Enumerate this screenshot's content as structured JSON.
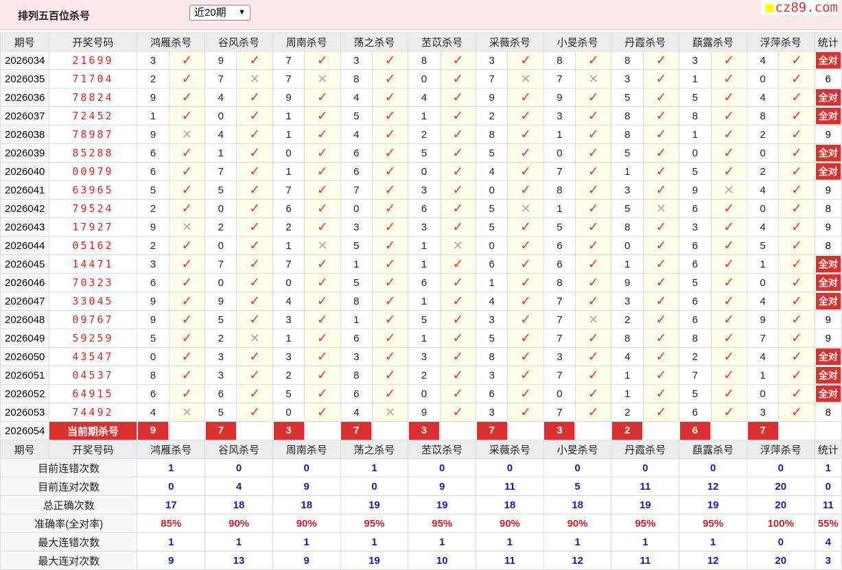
{
  "page": {
    "title": "排列五百位杀号",
    "period_select": "近20期",
    "watermark": "cz89.com"
  },
  "header": {
    "issue": "期号",
    "drawn": "开奖号码",
    "experts": [
      "鸿雁杀号",
      "谷风杀号",
      "周南杀号",
      "荡之杀号",
      "苤苡杀号",
      "采薇杀号",
      "小旻杀号",
      "丹霞杀号",
      "蕻露杀号",
      "浮萍杀号"
    ],
    "total": "统计"
  },
  "rows": [
    {
      "issue": "2026034",
      "drawn": "21699",
      "picks": [
        "3",
        "9",
        "7",
        "3",
        "8",
        "3",
        "8",
        "8",
        "3",
        "4"
      ],
      "ok": [
        1,
        1,
        1,
        1,
        1,
        1,
        1,
        1,
        1,
        1
      ],
      "total": "全对"
    },
    {
      "issue": "2026035",
      "drawn": "71704",
      "picks": [
        "2",
        "7",
        "7",
        "8",
        "0",
        "7",
        "7",
        "3",
        "1",
        "0"
      ],
      "ok": [
        1,
        0,
        0,
        1,
        1,
        0,
        0,
        1,
        1,
        1
      ],
      "total": "6"
    },
    {
      "issue": "2026036",
      "drawn": "78824",
      "picks": [
        "9",
        "4",
        "9",
        "4",
        "4",
        "9",
        "9",
        "5",
        "5",
        "4"
      ],
      "ok": [
        1,
        1,
        1,
        1,
        1,
        1,
        1,
        1,
        1,
        1
      ],
      "total": "全对"
    },
    {
      "issue": "2026037",
      "drawn": "72452",
      "picks": [
        "1",
        "0",
        "1",
        "5",
        "1",
        "2",
        "3",
        "8",
        "8",
        "8"
      ],
      "ok": [
        1,
        1,
        1,
        1,
        1,
        1,
        1,
        1,
        1,
        1
      ],
      "total": "全对"
    },
    {
      "issue": "2026038",
      "drawn": "78987",
      "picks": [
        "9",
        "4",
        "1",
        "4",
        "2",
        "8",
        "1",
        "8",
        "1",
        "2"
      ],
      "ok": [
        0,
        1,
        1,
        1,
        1,
        1,
        1,
        1,
        1,
        1
      ],
      "total": "9"
    },
    {
      "issue": "2026039",
      "drawn": "85288",
      "picks": [
        "6",
        "1",
        "0",
        "6",
        "5",
        "5",
        "0",
        "5",
        "0",
        "0"
      ],
      "ok": [
        1,
        1,
        1,
        1,
        1,
        1,
        1,
        1,
        1,
        1
      ],
      "total": "全对"
    },
    {
      "issue": "2026040",
      "drawn": "00979",
      "picks": [
        "6",
        "7",
        "1",
        "6",
        "0",
        "4",
        "7",
        "1",
        "5",
        "2"
      ],
      "ok": [
        1,
        1,
        1,
        1,
        1,
        1,
        1,
        1,
        1,
        1
      ],
      "total": "全对"
    },
    {
      "issue": "2026041",
      "drawn": "63965",
      "picks": [
        "5",
        "5",
        "7",
        "7",
        "3",
        "0",
        "8",
        "3",
        "9",
        "4"
      ],
      "ok": [
        1,
        1,
        1,
        1,
        1,
        1,
        1,
        1,
        0,
        1
      ],
      "total": "9"
    },
    {
      "issue": "2026042",
      "drawn": "79524",
      "picks": [
        "2",
        "0",
        "6",
        "0",
        "6",
        "5",
        "1",
        "5",
        "6",
        "0"
      ],
      "ok": [
        1,
        1,
        1,
        1,
        1,
        0,
        1,
        0,
        1,
        1
      ],
      "total": "8"
    },
    {
      "issue": "2026043",
      "drawn": "17927",
      "picks": [
        "9",
        "2",
        "2",
        "3",
        "3",
        "5",
        "5",
        "8",
        "3",
        "4"
      ],
      "ok": [
        0,
        1,
        1,
        1,
        1,
        1,
        1,
        1,
        1,
        1
      ],
      "total": "9"
    },
    {
      "issue": "2026044",
      "drawn": "05162",
      "picks": [
        "2",
        "0",
        "1",
        "5",
        "1",
        "0",
        "6",
        "0",
        "6",
        "5"
      ],
      "ok": [
        1,
        1,
        0,
        1,
        0,
        1,
        1,
        1,
        1,
        1
      ],
      "total": "8"
    },
    {
      "issue": "2026045",
      "drawn": "14471",
      "picks": [
        "3",
        "7",
        "7",
        "1",
        "1",
        "6",
        "6",
        "1",
        "6",
        "1"
      ],
      "ok": [
        1,
        1,
        1,
        1,
        1,
        1,
        1,
        1,
        1,
        1
      ],
      "total": "全对"
    },
    {
      "issue": "2026046",
      "drawn": "70323",
      "picks": [
        "6",
        "0",
        "0",
        "5",
        "6",
        "1",
        "8",
        "9",
        "5",
        "0"
      ],
      "ok": [
        1,
        1,
        1,
        1,
        1,
        1,
        1,
        1,
        1,
        1
      ],
      "total": "全对"
    },
    {
      "issue": "2026047",
      "drawn": "33045",
      "picks": [
        "9",
        "9",
        "4",
        "8",
        "1",
        "4",
        "7",
        "3",
        "6",
        "4"
      ],
      "ok": [
        1,
        1,
        1,
        1,
        1,
        1,
        1,
        1,
        1,
        1
      ],
      "total": "全对"
    },
    {
      "issue": "2026048",
      "drawn": "09767",
      "picks": [
        "9",
        "5",
        "3",
        "1",
        "5",
        "3",
        "7",
        "2",
        "6",
        "9"
      ],
      "ok": [
        1,
        1,
        1,
        1,
        1,
        1,
        0,
        1,
        1,
        1
      ],
      "total": "9"
    },
    {
      "issue": "2026049",
      "drawn": "59259",
      "picks": [
        "5",
        "2",
        "1",
        "6",
        "1",
        "5",
        "7",
        "8",
        "8",
        "7"
      ],
      "ok": [
        1,
        0,
        1,
        1,
        1,
        1,
        1,
        1,
        1,
        1
      ],
      "total": "9"
    },
    {
      "issue": "2026050",
      "drawn": "43547",
      "picks": [
        "0",
        "3",
        "3",
        "3",
        "3",
        "8",
        "3",
        "4",
        "2",
        "4"
      ],
      "ok": [
        1,
        1,
        1,
        1,
        1,
        1,
        1,
        1,
        1,
        1
      ],
      "total": "全对"
    },
    {
      "issue": "2026051",
      "drawn": "04537",
      "picks": [
        "8",
        "3",
        "2",
        "8",
        "2",
        "3",
        "7",
        "1",
        "7",
        "1"
      ],
      "ok": [
        1,
        1,
        1,
        1,
        1,
        1,
        1,
        1,
        1,
        1
      ],
      "total": "全对"
    },
    {
      "issue": "2026052",
      "drawn": "64915",
      "picks": [
        "6",
        "6",
        "5",
        "6",
        "0",
        "6",
        "0",
        "1",
        "5",
        "0"
      ],
      "ok": [
        1,
        1,
        1,
        1,
        1,
        1,
        1,
        1,
        1,
        1
      ],
      "total": "全对"
    },
    {
      "issue": "2026053",
      "drawn": "74492",
      "picks": [
        "4",
        "5",
        "0",
        "4",
        "9",
        "3",
        "7",
        "2",
        "6",
        "3"
      ],
      "ok": [
        0,
        1,
        1,
        0,
        1,
        1,
        1,
        1,
        1,
        1
      ],
      "total": "8"
    }
  ],
  "current": {
    "issue": "2026054",
    "label": "当前期杀号",
    "picks": [
      "9",
      "7",
      "3",
      "7",
      "3",
      "7",
      "3",
      "2",
      "6",
      "7"
    ]
  },
  "stats": [
    {
      "label": "目前连错次数",
      "values": [
        "1",
        "0",
        "0",
        "1",
        "0",
        "0",
        "0",
        "0",
        "0",
        "0"
      ],
      "total": "1",
      "red": false
    },
    {
      "label": "目前连对次数",
      "values": [
        "0",
        "4",
        "9",
        "0",
        "9",
        "11",
        "5",
        "11",
        "12",
        "20"
      ],
      "total": "0",
      "red": false
    },
    {
      "label": "总正确次数",
      "values": [
        "17",
        "18",
        "18",
        "19",
        "19",
        "18",
        "18",
        "19",
        "19",
        "20"
      ],
      "total": "11",
      "red": false
    },
    {
      "label": "准确率(全对率)",
      "values": [
        "85%",
        "90%",
        "90%",
        "95%",
        "95%",
        "90%",
        "90%",
        "95%",
        "95%",
        "100%"
      ],
      "total": "55%",
      "red": true
    },
    {
      "label": "最大连错次数",
      "values": [
        "1",
        "1",
        "1",
        "1",
        "1",
        "1",
        "1",
        "1",
        "1",
        "0"
      ],
      "total": "4",
      "red": false
    },
    {
      "label": "最大连对次数",
      "values": [
        "9",
        "13",
        "9",
        "19",
        "10",
        "11",
        "12",
        "11",
        "12",
        "20"
      ],
      "total": "3",
      "red": false
    }
  ],
  "marks": {
    "right": "✓",
    "wrong": "✕"
  },
  "colors": {
    "accent_red": "#d93030",
    "stat_blue": "#1a1aa6",
    "topbar": "#fbe8ea",
    "mark_bg": "#fffdea"
  }
}
